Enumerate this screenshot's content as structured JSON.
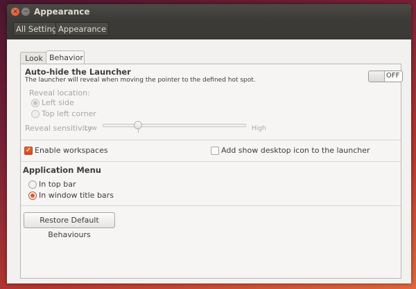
{
  "window": {
    "title": "Appearance",
    "close_glyph": "×",
    "minimize_glyph": "−"
  },
  "toolbar": {
    "all_settings": "All Settings",
    "current": "Appearance"
  },
  "tabs": [
    {
      "label": "Look",
      "active": false
    },
    {
      "label": "Behavior",
      "active": true
    }
  ],
  "autohide": {
    "heading": "Auto-hide the Launcher",
    "description": "The launcher will reveal when moving the pointer to the defined hot spot.",
    "toggle_label": "OFF",
    "toggle_on": false,
    "reveal_location_label": "Reveal location:",
    "options": [
      {
        "label": "Left side",
        "selected": true,
        "enabled": false
      },
      {
        "label": "Top left corner",
        "selected": false,
        "enabled": false
      }
    ],
    "sensitivity_label": "Reveal sensitivity",
    "sensitivity_low": "Low",
    "sensitivity_high": "High",
    "sensitivity_value": 0.25
  },
  "workspaces": {
    "enable_label": "Enable workspaces",
    "enable_checked": true,
    "desktop_icon_label": "Add show desktop icon to the launcher",
    "desktop_icon_checked": false
  },
  "app_menu": {
    "heading": "Application Menu",
    "options": [
      {
        "label": "In top bar",
        "selected": false
      },
      {
        "label": "In window title bars",
        "selected": true
      }
    ]
  },
  "restore_button": "Restore Default Behaviours",
  "colors": {
    "accent": "#e0572d",
    "titlebar": "#3c3b37",
    "window_bg": "#f2f1f0"
  }
}
